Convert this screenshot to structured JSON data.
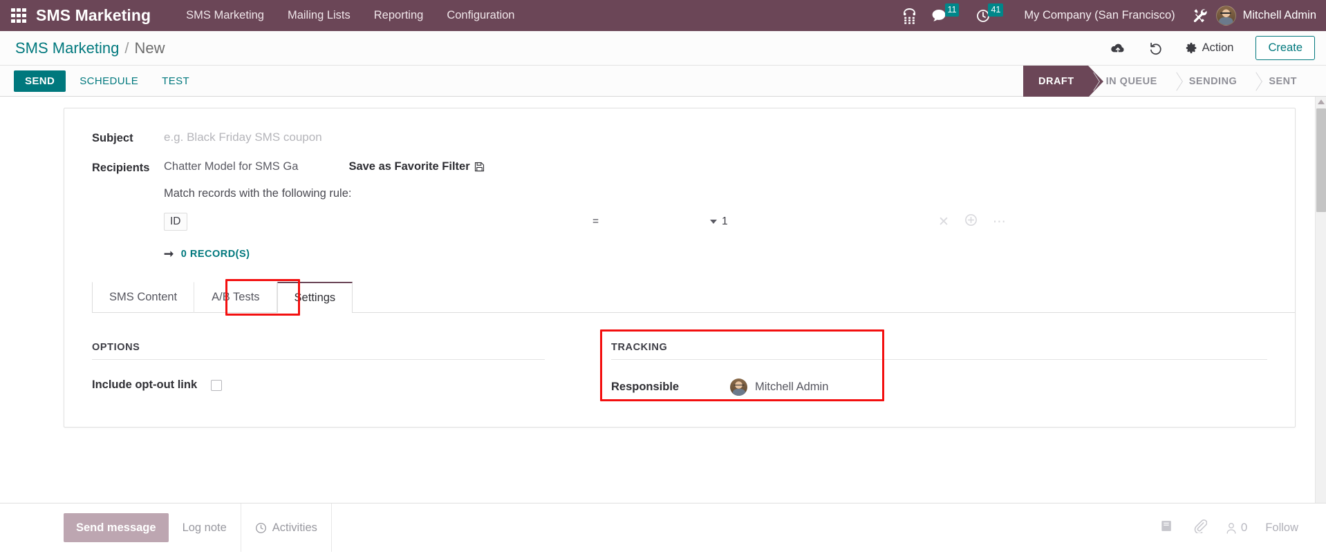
{
  "navbar": {
    "apps_icon": "apps-grid-icon",
    "brand": "SMS Marketing",
    "menus": [
      "SMS Marketing",
      "Mailing Lists",
      "Reporting",
      "Configuration"
    ],
    "phone_icon": "dialpad-phone-icon",
    "messages_icon": "chat-bubble-icon",
    "messages_count": "11",
    "activities_icon": "clock-icon",
    "activities_count": "41",
    "company": "My Company (San Francisco)",
    "tools_icon": "wrench-screwdriver-icon",
    "avatar": "user-avatar",
    "user": "Mitchell Admin"
  },
  "controlpanel": {
    "breadcrumb_root": "SMS Marketing",
    "breadcrumb_sep": "/",
    "breadcrumb_current": "New",
    "save_icon": "cloud-upload-icon",
    "discard_icon": "undo-icon",
    "action_gear_icon": "gear-icon",
    "action_label": "Action",
    "create_label": "Create"
  },
  "statusbuttons": {
    "send": "SEND",
    "schedule": "SCHEDULE",
    "test": "TEST"
  },
  "statusbar": {
    "stages": [
      "DRAFT",
      "IN QUEUE",
      "SENDING",
      "SENT"
    ],
    "active": "DRAFT",
    "active_color": "#6b4657"
  },
  "form": {
    "subject_label": "Subject",
    "subject_value": "",
    "subject_placeholder": "e.g. Black Friday SMS coupon",
    "recipients_label": "Recipients",
    "recipients_value": "Chatter Model for SMS Ga",
    "favorite_filter_label": "Save as Favorite Filter",
    "favorite_filter_icon": "floppy-save-icon",
    "match_text": "Match records with the following rule:",
    "rule": {
      "field": "ID",
      "operator": "=",
      "value": "1",
      "remove_icon": "close-x-icon",
      "add_icon": "plus-circle-icon",
      "more_icon": "ellipsis-icon"
    },
    "records_arrow_icon": "arrow-right-icon",
    "records_label": "0 RECORD(S)"
  },
  "notebook": {
    "tabs": [
      "SMS Content",
      "A/B Tests",
      "Settings"
    ],
    "active_tab": "Settings"
  },
  "settings": {
    "options_title": "OPTIONS",
    "optout_label": "Include opt-out link",
    "optout_checked": false,
    "tracking_title": "TRACKING",
    "responsible_label": "Responsible",
    "responsible_avatar": "user-avatar",
    "responsible_value": "Mitchell Admin"
  },
  "annotations": {
    "highlight_color": "#f30f0f",
    "boxes": [
      "settings-tab",
      "tracking-section"
    ]
  },
  "chatter": {
    "send_message": "Send message",
    "log_note": "Log note",
    "activities_icon": "clock-circle-icon",
    "activities": "Activities",
    "log_icon": "book-log-icon",
    "attachment_icon": "paperclip-icon",
    "followers_icon": "user-outline-icon",
    "followers_count": "0",
    "follow_label": "Follow"
  }
}
